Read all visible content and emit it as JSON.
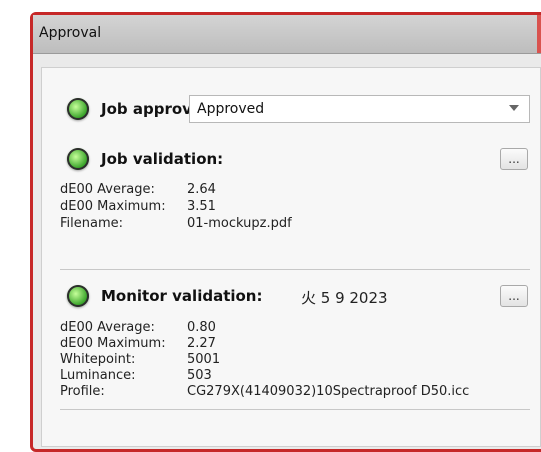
{
  "window": {
    "title": "Approval"
  },
  "job_approval": {
    "label": "Job approval:",
    "value": "Approved"
  },
  "job_validation": {
    "label": "Job validation:",
    "button": "...",
    "rows": [
      {
        "key": "dE00 Average:",
        "value": "2.64"
      },
      {
        "key": "dE00 Maximum:",
        "value": "3.51"
      },
      {
        "key": "Filename:",
        "value": "01-mockupz.pdf"
      }
    ]
  },
  "monitor_validation": {
    "label": "Monitor validation:",
    "date": "火 5 9 2023",
    "button": "...",
    "rows": [
      {
        "key": "dE00 Average:",
        "value": "0.80"
      },
      {
        "key": "dE00 Maximum:",
        "value": "2.27"
      },
      {
        "key": "Whitepoint:",
        "value": "5001"
      },
      {
        "key": "Luminance:",
        "value": "503"
      },
      {
        "key": "Profile:",
        "value": "CG279X(41409032)10Spectraproof D50.icc"
      }
    ]
  },
  "colors": {
    "border": "#c62828",
    "led": "#3ba52b"
  },
  "icons": {
    "status": "green-led-icon",
    "dropdown": "chevron-down-icon"
  }
}
